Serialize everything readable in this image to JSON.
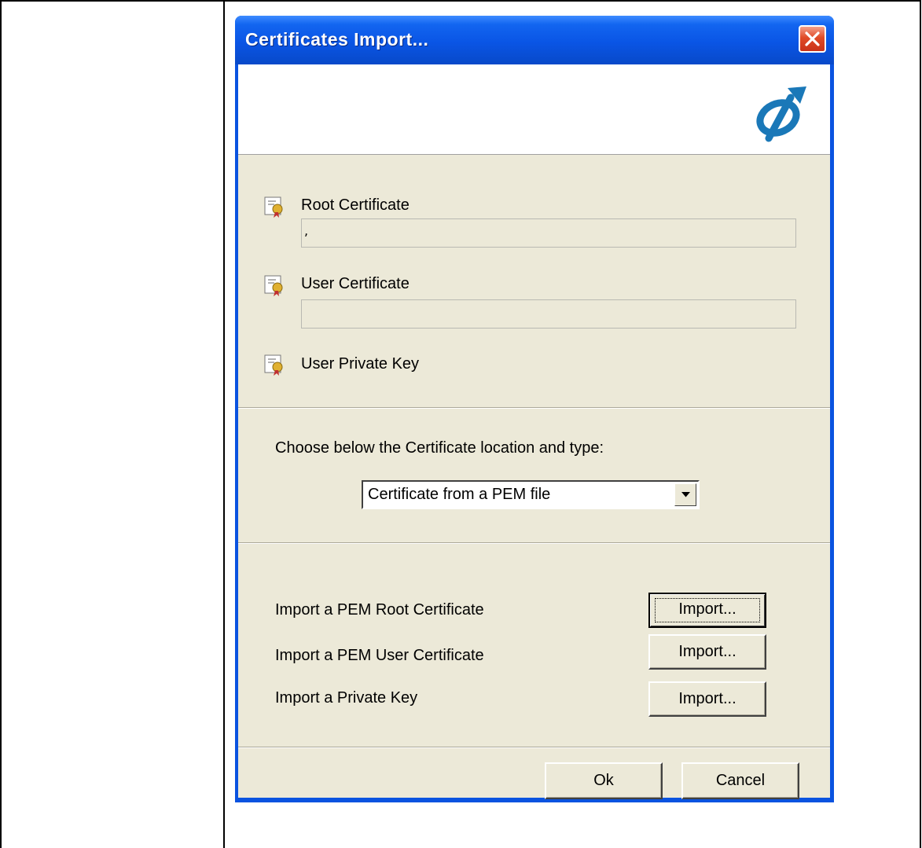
{
  "dialog": {
    "title": "Certificates Import...",
    "close_icon": "close-icon",
    "logo_icon": "app-logo"
  },
  "certificates": {
    "root_label": "Root Certificate",
    "root_value": ",",
    "user_label": "User Certificate",
    "user_value": "",
    "private_key_label": "User Private Key"
  },
  "location": {
    "prompt": "Choose below the Certificate location and type:",
    "selected": "Certificate from a PEM file"
  },
  "imports": [
    {
      "label": "Import a PEM Root Certificate",
      "button": "Import..."
    },
    {
      "label": "Import a PEM User Certificate",
      "button": "Import..."
    },
    {
      "label": "Import a Private Key",
      "button": "Import..."
    }
  ],
  "footer": {
    "ok": "Ok",
    "cancel": "Cancel"
  },
  "colors": {
    "titlebar": "#0a55e5",
    "dialog_bg": "#ece9d8",
    "close": "#e04b27"
  }
}
